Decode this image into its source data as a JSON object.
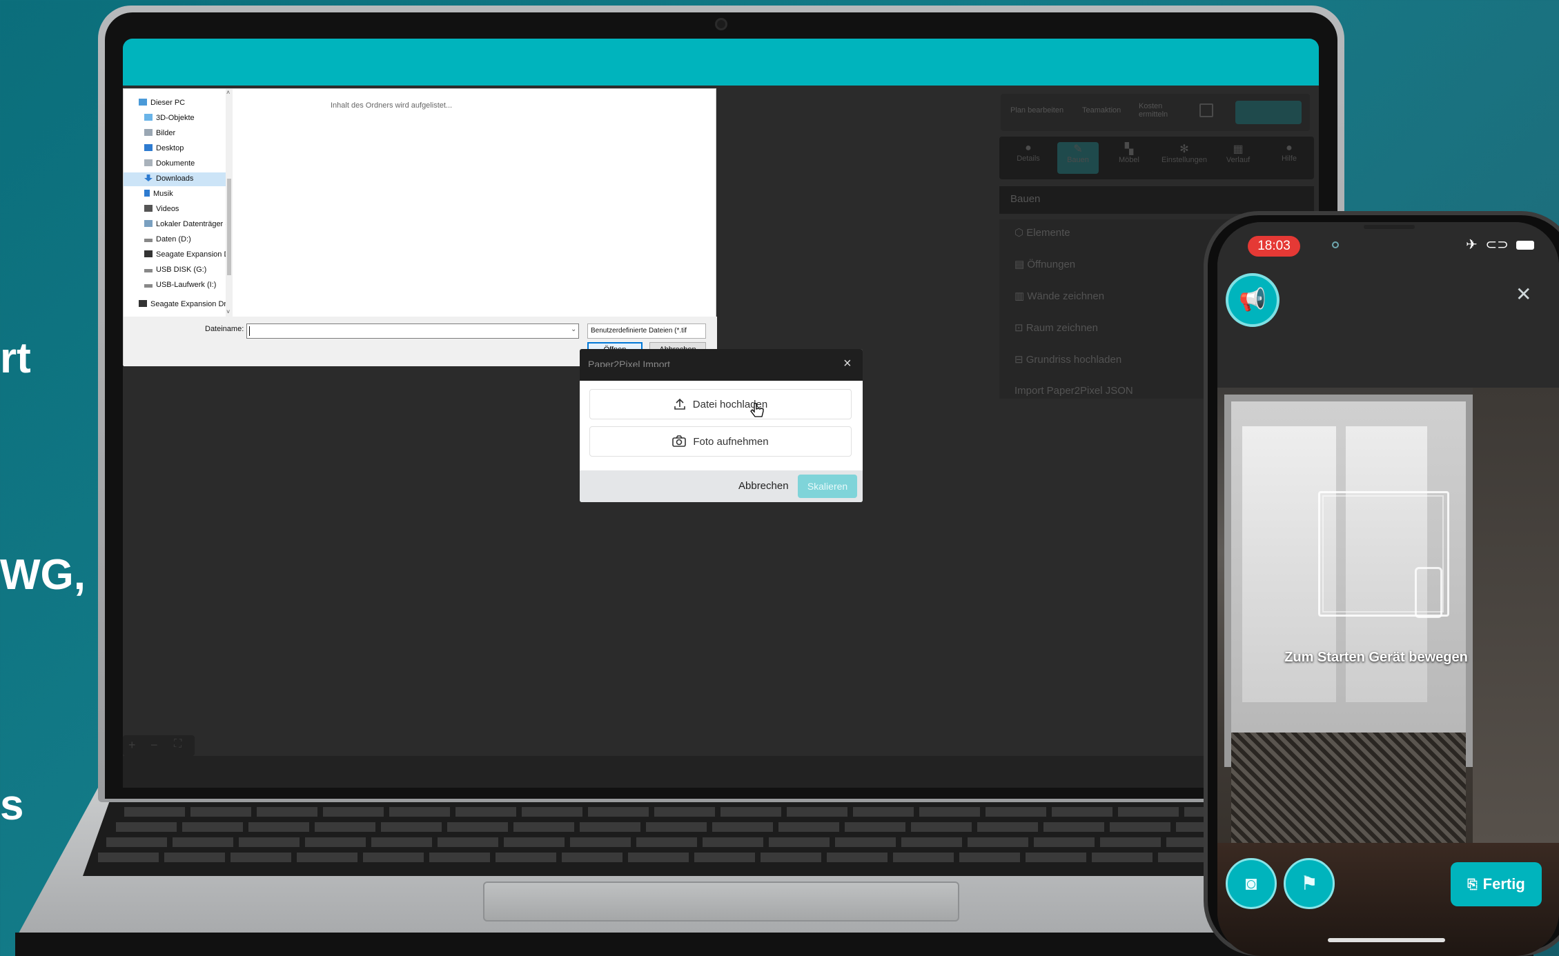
{
  "side_text": {
    "line1": "rt",
    "line2": "WG,",
    "line3": "s"
  },
  "app": {
    "toolbar": [
      {
        "label": "Plan bearbeiten"
      },
      {
        "label": "Teamaktion"
      },
      {
        "label": "Kosten ermitteln"
      }
    ],
    "tabs": [
      {
        "label": "Details"
      },
      {
        "label": "Bauen"
      },
      {
        "label": "Möbel"
      },
      {
        "label": "Einstellungen"
      },
      {
        "label": "Verlauf"
      },
      {
        "label": "Hilfe"
      }
    ],
    "panel_title": "Bauen",
    "panel_items": [
      {
        "label": "Elemente"
      },
      {
        "label": "Öffnungen"
      },
      {
        "label": "Wände zeichnen"
      },
      {
        "label": "Raum zeichnen"
      },
      {
        "label": "Grundriss hochladen"
      },
      {
        "label": "Import Paper2Pixel JSON"
      }
    ],
    "zoom": {
      "plus": "+",
      "minus": "−",
      "fit": "⛶"
    }
  },
  "file_dialog": {
    "tree": [
      {
        "label": "Dieser PC",
        "icon": "pc-icon"
      },
      {
        "label": "3D-Objekte",
        "icon": "cube-icon"
      },
      {
        "label": "Bilder",
        "icon": "pictures-icon"
      },
      {
        "label": "Desktop",
        "icon": "desktop-icon"
      },
      {
        "label": "Dokumente",
        "icon": "documents-icon"
      },
      {
        "label": "Downloads",
        "icon": "download-icon"
      },
      {
        "label": "Musik",
        "icon": "music-icon"
      },
      {
        "label": "Videos",
        "icon": "video-icon"
      },
      {
        "label": "Lokaler Datenträger (",
        "icon": "drive-icon"
      },
      {
        "label": "Daten (D:)",
        "icon": "drive-icon"
      },
      {
        "label": "Seagate Expansion D",
        "icon": "drive-icon"
      },
      {
        "label": "USB DISK (G:)",
        "icon": "usb-icon"
      },
      {
        "label": "USB-Laufwerk (I:)",
        "icon": "usb-icon"
      },
      {
        "label": "Seagate Expansion Dri",
        "icon": "drive-icon"
      }
    ],
    "folder_message": "Inhalt des Ordners wird aufgelistet...",
    "filename_label": "Dateiname:",
    "filename_value": "",
    "filetype": "Benutzerdefinierte Dateien (*.tif",
    "open_label": "Öffnen",
    "cancel_label": "Abbrechen"
  },
  "import_modal": {
    "title": "Paper2Pixel Import",
    "upload_label": "Datei hochladen",
    "photo_label": "Foto aufnehmen",
    "cancel_label": "Abbrechen",
    "submit_label": "Skalieren"
  },
  "phone": {
    "time": "18:03",
    "scan_hint": "Zum Starten Gerät bewegen",
    "done_label": "Fertig"
  },
  "colors": {
    "accent": "#00b4bd",
    "background": "#137b88",
    "danger": "#e53935"
  }
}
